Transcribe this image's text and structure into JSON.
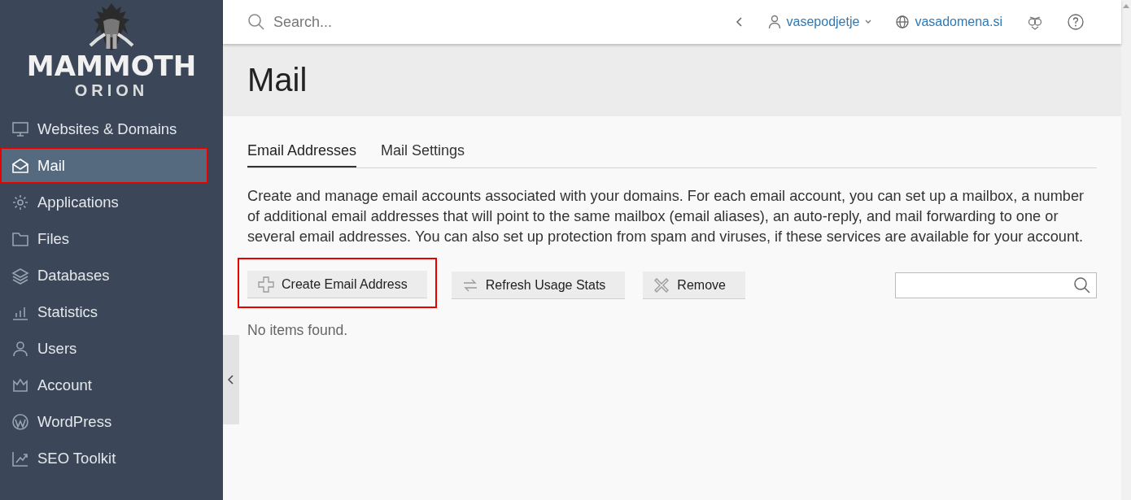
{
  "logo": {
    "title": "MAMMOTH",
    "subtitle": "ORION"
  },
  "sidebar": {
    "items": [
      {
        "label": "Websites & Domains",
        "selected": false,
        "highlighted": false
      },
      {
        "label": "Mail",
        "selected": true,
        "highlighted": true
      },
      {
        "label": "Applications",
        "selected": false,
        "highlighted": false
      },
      {
        "label": "Files",
        "selected": false,
        "highlighted": false
      },
      {
        "label": "Databases",
        "selected": false,
        "highlighted": false
      },
      {
        "label": "Statistics",
        "selected": false,
        "highlighted": false
      },
      {
        "label": "Users",
        "selected": false,
        "highlighted": false
      },
      {
        "label": "Account",
        "selected": false,
        "highlighted": false
      },
      {
        "label": "WordPress",
        "selected": false,
        "highlighted": false
      },
      {
        "label": "SEO Toolkit",
        "selected": false,
        "highlighted": false
      }
    ]
  },
  "topbar": {
    "search": {
      "placeholder": "Search..."
    },
    "user": "vasepodjetje",
    "domain": "vasadomena.si"
  },
  "page": {
    "title": "Mail",
    "tabs": [
      {
        "label": "Email Addresses",
        "selected": true
      },
      {
        "label": "Mail Settings",
        "selected": false
      }
    ],
    "description": "Create and manage email accounts associated with your domains. For each email account, you can set up a mailbox, a number of additional email addresses that will point to the same mailbox (email aliases), an auto-reply, and mail forwarding to one or several email addresses. You can also set up protection from spam and viruses, if these services are available for your account.",
    "buttons": [
      {
        "label": "Create Email Address",
        "highlighted": true
      },
      {
        "label": "Refresh Usage Stats",
        "highlighted": false
      },
      {
        "label": "Remove",
        "highlighted": false
      }
    ],
    "empty_message": "No items found."
  }
}
